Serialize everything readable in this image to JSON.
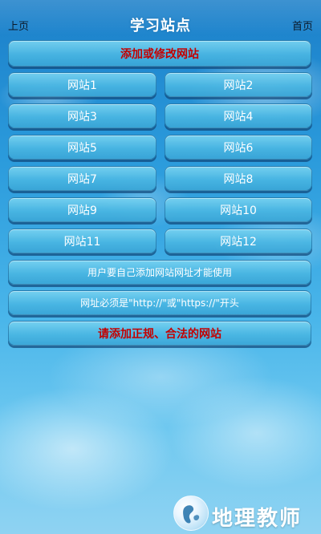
{
  "header": {
    "back_label": "上页",
    "title": "学习站点",
    "home_label": "首页"
  },
  "actions": {
    "add_or_modify_label": "添加或修改网站"
  },
  "sites": [
    {
      "label": "网站1"
    },
    {
      "label": "网站2"
    },
    {
      "label": "网站3"
    },
    {
      "label": "网站4"
    },
    {
      "label": "网站5"
    },
    {
      "label": "网站6"
    },
    {
      "label": "网站7"
    },
    {
      "label": "网站8"
    },
    {
      "label": "网站9"
    },
    {
      "label": "网站10"
    },
    {
      "label": "网站11"
    },
    {
      "label": "网站12"
    }
  ],
  "notes": {
    "usage_note": "用户要自己添加网站网址才能使用",
    "url_prefix_note": "网址必须是\"http://\"或\"https://\"开头",
    "legal_note": "请添加正规、合法的网站"
  },
  "brand": {
    "logo_text": "地理教师"
  },
  "colors": {
    "warning_red": "#c40000",
    "button_blue": "#4ab6e2",
    "sky_blue": "#2b9bdc"
  }
}
